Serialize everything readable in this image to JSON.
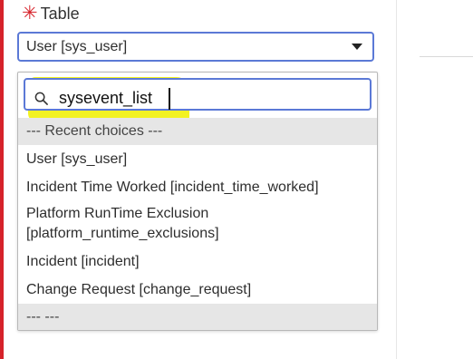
{
  "field": {
    "required_marker": "✳",
    "label": "Table",
    "selected_value": "User [sys_user]"
  },
  "dropdown": {
    "search_value": "sysevent_list",
    "options": [
      {
        "label": "--- Recent choices ---",
        "kind": "group"
      },
      {
        "label": "User [sys_user]",
        "kind": "option"
      },
      {
        "label": "Incident Time Worked [incident_time_worked]",
        "kind": "option"
      },
      {
        "label": "Platform RunTime Exclusion",
        "label2": "[platform_runtime_exclusions]",
        "kind": "option"
      },
      {
        "label": "Incident [incident]",
        "kind": "option"
      },
      {
        "label": "Change Request [change_request]",
        "kind": "option"
      },
      {
        "label": "--- ---",
        "kind": "group"
      }
    ]
  },
  "colors": {
    "accent": "#5b79d6",
    "required": "#d6222a",
    "highlight": "#f2f21b",
    "group_bg": "#e6e6e6"
  }
}
